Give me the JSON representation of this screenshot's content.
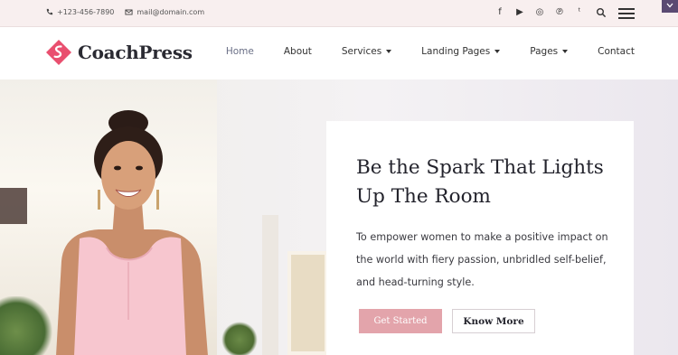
{
  "topbar": {
    "phone": "+123-456-7890",
    "email": "mail@domain.com",
    "social": [
      {
        "name": "facebook-icon",
        "glyph": "f"
      },
      {
        "name": "youtube-icon",
        "glyph": "▶"
      },
      {
        "name": "instagram-icon",
        "glyph": "◎"
      },
      {
        "name": "pinterest-icon",
        "glyph": "℗"
      },
      {
        "name": "twitter-icon",
        "glyph": "ᵗ"
      }
    ]
  },
  "header": {
    "logo_text": "CoachPress",
    "nav": [
      {
        "label": "Home",
        "active": true,
        "dropdown": false
      },
      {
        "label": "About",
        "active": false,
        "dropdown": false
      },
      {
        "label": "Services",
        "active": false,
        "dropdown": true
      },
      {
        "label": "Landing Pages",
        "active": false,
        "dropdown": true
      },
      {
        "label": "Pages",
        "active": false,
        "dropdown": true
      },
      {
        "label": "Contact",
        "active": false,
        "dropdown": false
      }
    ]
  },
  "hero": {
    "title": "Be the Spark That Lights Up The Room",
    "text": "To empower women to make a positive impact on the world with fiery passion, unbridled self-belief, and head-turning style.",
    "primary_button": "Get Started",
    "secondary_button": "Know More"
  },
  "colors": {
    "accent": "#e3a4ab",
    "topbar_bg": "#f8efef",
    "corner_toggle": "#5a4a72",
    "brand_mark": "#e94f6f"
  }
}
